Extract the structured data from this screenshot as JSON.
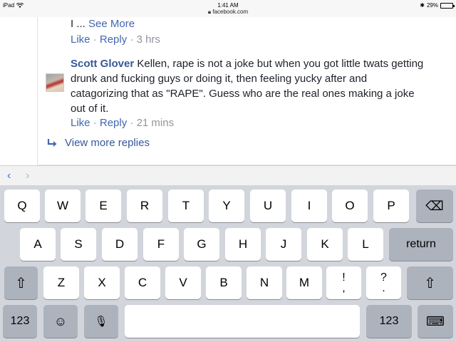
{
  "statusbar": {
    "device": "iPad",
    "time": "1:41 AM",
    "url": "facebook.com",
    "battery": "29%",
    "battery_level": 0.29
  },
  "content": {
    "prev_text": "I ...",
    "see_more": "See More",
    "prev_actions": {
      "like": "Like",
      "sep1": " · ",
      "reply": "Reply",
      "sep2": " · ",
      "time": "3 hrs"
    },
    "comment": {
      "author": "Scott Glover",
      "text": "Kellen, rape is not a joke but when you got little twats getting drunk and fucking guys or doing it, then feeling yucky after and catagorizing that as \"RAPE\". Guess who are the real ones making a joke out of it."
    },
    "comment_actions": {
      "like": "Like",
      "sep1": " · ",
      "reply": "Reply",
      "sep2": " · ",
      "time": "21 mins"
    },
    "view_more": "View more replies"
  },
  "nav": {
    "back": "‹",
    "forward": "›"
  },
  "keyboard": {
    "row1": [
      "Q",
      "W",
      "E",
      "R",
      "T",
      "Y",
      "U",
      "I",
      "O",
      "P"
    ],
    "row2": [
      "A",
      "S",
      "D",
      "F",
      "G",
      "H",
      "J",
      "K",
      "L"
    ],
    "row3": [
      "Z",
      "X",
      "C",
      "V",
      "B",
      "N",
      "M"
    ],
    "punct1": {
      "top": "!",
      "bottom": ","
    },
    "punct2": {
      "top": "?",
      "bottom": "."
    },
    "return_label": "return",
    "numbers_label": "123",
    "emoji_glyph": "☺",
    "mic_glyph": "🎙",
    "shift_glyph": "⇧",
    "delete_glyph": "⌫",
    "hide_glyph": "⌨"
  }
}
